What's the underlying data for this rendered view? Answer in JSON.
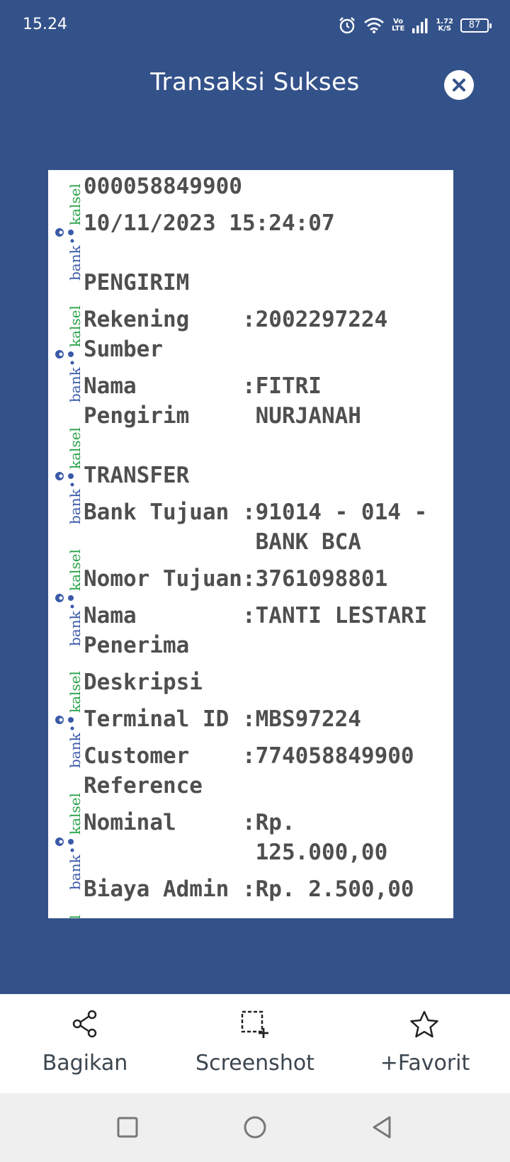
{
  "status_bar": {
    "time": "15.24",
    "volte_top": "Vo",
    "volte_bottom": "LTE",
    "speed_top": "1.72",
    "speed_bottom": "K/S",
    "battery": "87"
  },
  "header": {
    "title": "Transaksi Sukses",
    "close_icon": "close-icon"
  },
  "receipt": {
    "watermark_text": [
      "bank",
      "kalsel"
    ],
    "lines": [
      "000058849900",
      "10/11/2023 15:24:07",
      "PENGIRIM",
      "Rekening    :2002297224",
      "Sumber",
      "Nama        :FITRI",
      "Pengirim     NURJANAH",
      "TRANSFER",
      "Bank Tujuan :91014 - 014 -",
      "             BANK BCA",
      "Nomor Tujuan:3761098801",
      "Nama        :TANTI LESTARI",
      "Penerima",
      "Deskripsi",
      "Terminal ID :MBS97224",
      "Customer    :774058849900",
      "Reference",
      "Nominal     :Rp.",
      "             125.000,00",
      "Biaya Admin :Rp. 2.500,00"
    ]
  },
  "actions": [
    {
      "label": "Bagikan",
      "icon": "share-icon"
    },
    {
      "label": "Screenshot",
      "icon": "screenshot-icon"
    },
    {
      "label": "+Favorit",
      "icon": "star-icon"
    }
  ],
  "nav": {
    "recents_icon": "square-icon",
    "home_icon": "circle-icon",
    "back_icon": "triangle-back-icon"
  },
  "colors": {
    "background": "#34528a",
    "receipt_text": "#4f4f4f",
    "watermark_blue": "#3a5aa8",
    "watermark_green": "#2aa34a"
  }
}
